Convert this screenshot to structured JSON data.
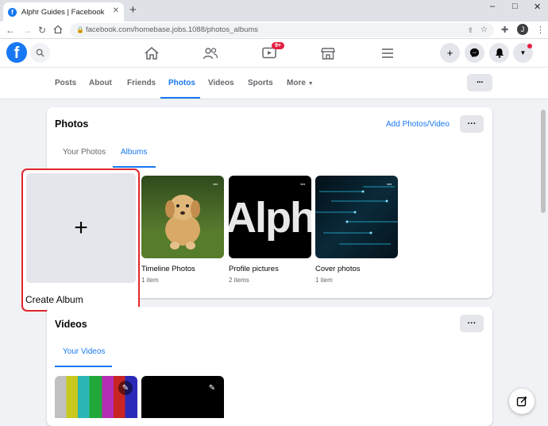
{
  "browser": {
    "tab_title": "Alphr Guides | Facebook",
    "tab_close": "✕",
    "new_tab": "+",
    "win_min": "–",
    "win_max": "□",
    "win_close": "✕",
    "url": "facebook.com/homebase.jobs.1088/photos_albums",
    "profile_initial": "J"
  },
  "fb_header": {
    "logo": "f",
    "notification_badge": "9+"
  },
  "profile_nav": {
    "items": [
      "Posts",
      "About",
      "Friends",
      "Photos",
      "Videos",
      "Sports",
      "More"
    ],
    "active": "Photos",
    "more_caret": "▼",
    "dots": "···"
  },
  "photos_card": {
    "title": "Photos",
    "add_link": "Add Photos/Video",
    "dots": "···",
    "tabs": [
      "Your Photos",
      "Albums"
    ],
    "active_tab": "Albums",
    "create_album": {
      "label": "Create Album",
      "icon": "+"
    },
    "albums": [
      {
        "name": "Timeline Photos",
        "count": "1 item",
        "dots": "···"
      },
      {
        "name": "Profile pictures",
        "count": "2 items",
        "dots": "···",
        "thumb_text": "Alph"
      },
      {
        "name": "Cover photos",
        "count": "1 item",
        "dots": "···"
      }
    ]
  },
  "videos_card": {
    "title": "Videos",
    "dots": "···",
    "tab": "Your Videos"
  },
  "colors": {
    "fb_blue": "#1877f2",
    "highlight_red": "#e0262b",
    "page_bg": "#f0f2f5"
  }
}
